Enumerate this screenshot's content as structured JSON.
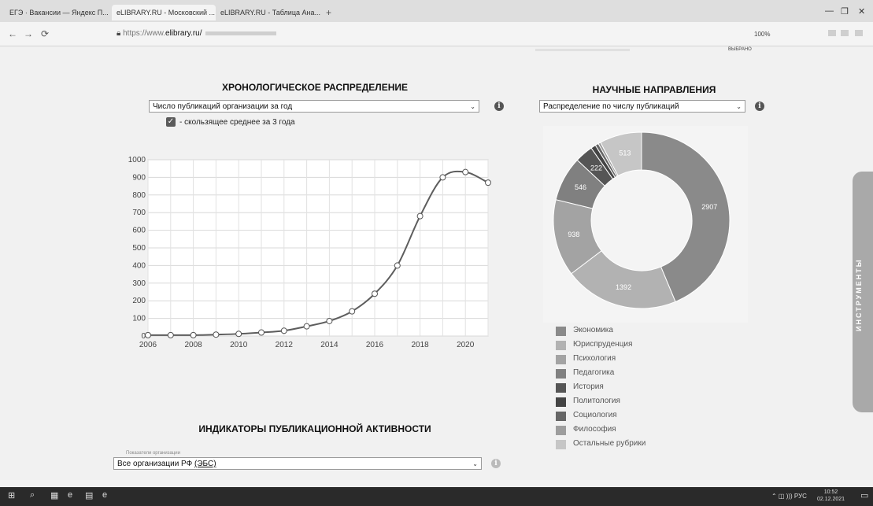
{
  "browser": {
    "tabs": [
      {
        "label": "ЕГЭ · Вакансии — Яндекс П...",
        "close": "×"
      },
      {
        "label": "eLIBRARY.RU - Московский ...",
        "close": "×"
      },
      {
        "label": "eLIBRARY.RU - Таблица Ана...",
        "close": "×"
      }
    ],
    "new_tab": "+",
    "window_controls": {
      "minimize": "—",
      "restore": "❐",
      "close": "✕"
    },
    "nav": {
      "back": "←",
      "forward": "→",
      "reload": "⟳"
    },
    "address": {
      "scheme": "https://www.",
      "host": "elibrary.ru/"
    },
    "zoom": "100%",
    "right_chip": "ВЫБРАНО"
  },
  "chronology": {
    "title": "ХРОНОЛОГИЧЕСКОЕ РАСПРЕДЕЛЕНИЕ",
    "select_value": "Число публикаций организации за год",
    "select_arrow": "⌄",
    "info": "i",
    "checkbox_mark": "✓",
    "moving_average_label": "- скользящее среднее за 3 года"
  },
  "fields": {
    "title": "НАУЧНЫЕ НАПРАВЛЕНИЯ",
    "select_value": "Распределение по числу публикаций",
    "select_arrow": "⌄",
    "info": "i"
  },
  "indicators": {
    "title": "ИНДИКАТОРЫ ПУБЛИКАЦИОННОЙ АКТИВНОСТИ",
    "caption": "Показатели организации",
    "select_value": "Все организации РФ",
    "select_value_link": "(ЭБС)",
    "select_arrow": "⌄",
    "info": "i"
  },
  "tools_tab": "ИНСТРУМЕНТЫ",
  "taskbar": {
    "start": "⊞",
    "search": "⌕",
    "icons": [
      "▦",
      "e",
      "▤",
      "e"
    ],
    "tray": "⌃ ◫ ))) РУС",
    "time": "10:52",
    "date": "02.12.2021",
    "notifications": "▭"
  },
  "colors": {
    "line": "#5d5d5d",
    "donut": [
      "#8a8a8a",
      "#b2b2b2",
      "#a3a3a3",
      "#808080",
      "#555555",
      "#444444",
      "#666666",
      "#9d9d9d",
      "#c6c6c6"
    ]
  },
  "chart_data": [
    {
      "type": "line",
      "x": [
        2006,
        2007,
        2008,
        2009,
        2010,
        2011,
        2012,
        2013,
        2014,
        2015,
        2016,
        2017,
        2018,
        2019,
        2020,
        2021
      ],
      "series": [
        {
          "values": [
            5,
            5,
            5,
            8,
            12,
            20,
            30,
            55,
            85,
            140,
            240,
            400,
            680,
            900,
            930,
            870
          ]
        }
      ],
      "xticks": [
        "2006",
        "2008",
        "2010",
        "2012",
        "2014",
        "2016",
        "2018",
        "2020"
      ],
      "yticks": [
        "0",
        "100",
        "200",
        "300",
        "400",
        "500",
        "600",
        "700",
        "800",
        "900",
        "1000"
      ],
      "xlim": [
        2006,
        2021
      ],
      "ylim": [
        0,
        1000
      ],
      "grid": true
    },
    {
      "type": "pie",
      "style": "donut",
      "labels": [
        "Экономика",
        "Юриспруденция",
        "Психология",
        "Педагогика",
        "История",
        "Политология",
        "Социология",
        "Философия",
        "Остальные рубрики"
      ],
      "values": [
        2907,
        1392,
        938,
        546,
        222,
        60,
        40,
        30,
        513
      ],
      "data_labels": [
        "2907",
        "1392",
        "938",
        "546",
        "222",
        "",
        "",
        "",
        "513"
      ],
      "legend_position": "bottom"
    }
  ]
}
